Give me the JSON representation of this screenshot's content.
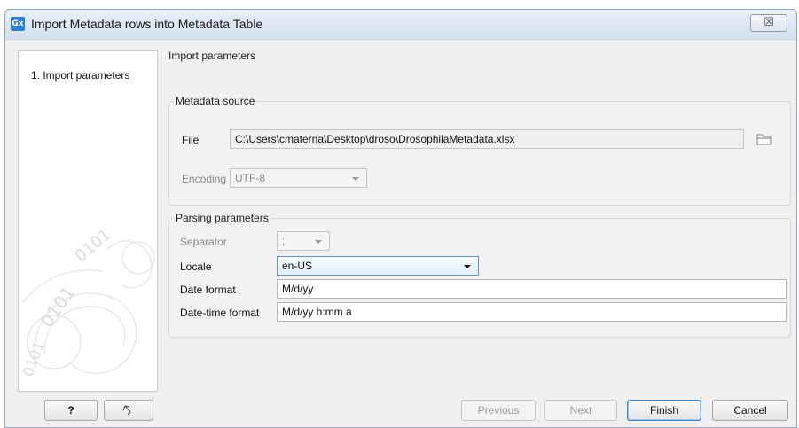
{
  "window": {
    "app_icon_text": "Gx",
    "title": "Import Metadata rows into Metadata Table",
    "close_glyph": "☒"
  },
  "sidebar": {
    "steps": [
      {
        "label": "1.  Import parameters"
      }
    ]
  },
  "content": {
    "heading": "Import parameters",
    "metadata_source": {
      "title": "Metadata source",
      "file_label": "File",
      "file_value": "C:\\Users\\cmaterna\\Desktop\\droso\\DrosophilaMetadata.xlsx",
      "encoding_label": "Encoding",
      "encoding_value": "UTF-8"
    },
    "parsing": {
      "title": "Parsing parameters",
      "separator_label": "Separator",
      "separator_value": ";",
      "locale_label": "Locale",
      "locale_value": "en-US",
      "date_format_label": "Date format",
      "date_format_value": "M/d/yy",
      "datetime_format_label": "Date-time format",
      "datetime_format_value": "M/d/yy h:mm a"
    }
  },
  "footer": {
    "help_label": "?",
    "previous_label": "Previous",
    "next_label": "Next",
    "finish_label": "Finish",
    "cancel_label": "Cancel"
  },
  "icons": {
    "app": "app-icon",
    "close": "close-icon",
    "folder": "folder-icon",
    "reset": "undo-icon"
  },
  "colors": {
    "title_bar": "#dde7f3",
    "accent": "#3b85d4",
    "app_icon": "#2f7fd6"
  }
}
